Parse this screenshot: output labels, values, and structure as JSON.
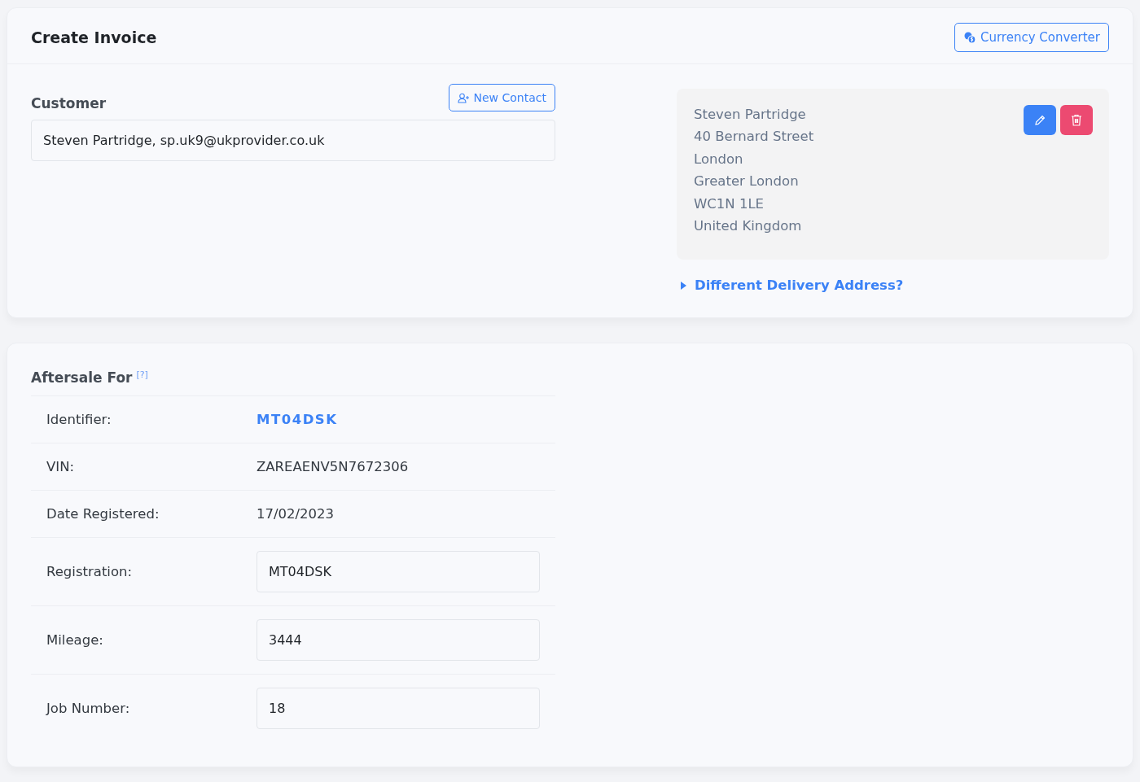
{
  "header": {
    "title": "Create Invoice",
    "currency_button": "Currency Converter"
  },
  "customer": {
    "label": "Customer",
    "new_contact_button": "New Contact",
    "value": "Steven Partridge, sp.uk9@ukprovider.co.uk"
  },
  "address": {
    "lines": [
      "Steven Partridge",
      "40 Bernard Street",
      "London",
      "Greater London",
      "WC1N 1LE",
      "United Kingdom"
    ]
  },
  "delivery_toggle": {
    "label": "Different Delivery Address?",
    "expanded": false
  },
  "aftersale": {
    "title": "Aftersale For",
    "help": "[?]",
    "rows": [
      {
        "label": "Identifier:",
        "kind": "link",
        "value": "MT04DSK"
      },
      {
        "label": "VIN:",
        "kind": "text",
        "value": "ZAREAENV5N7672306"
      },
      {
        "label": "Date Registered:",
        "kind": "text",
        "value": "17/02/2023"
      },
      {
        "label": "Registration:",
        "kind": "input",
        "value": "MT04DSK"
      },
      {
        "label": "Mileage:",
        "kind": "input",
        "value": "3444"
      },
      {
        "label": "Job Number:",
        "kind": "input",
        "value": "18"
      }
    ]
  }
}
